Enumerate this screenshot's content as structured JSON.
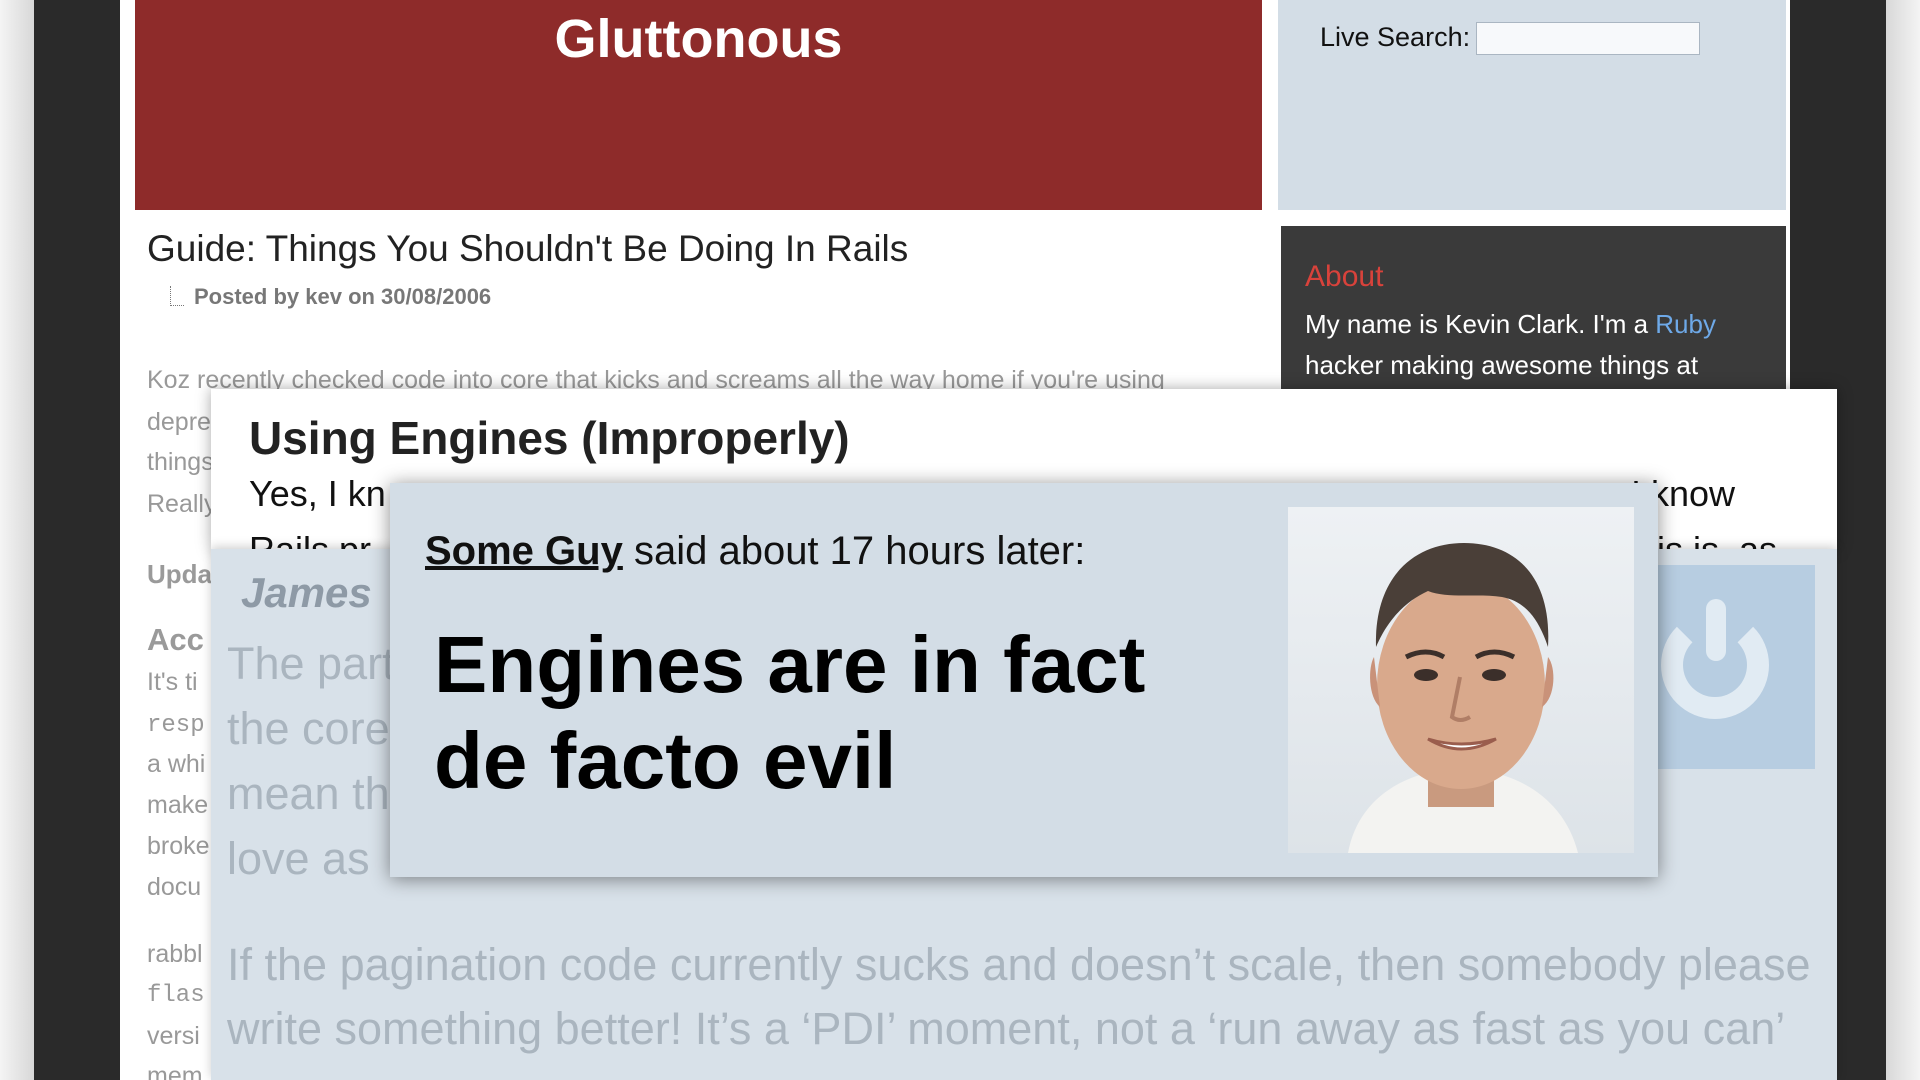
{
  "banner": {
    "title": "Gluttonous"
  },
  "search": {
    "label": "Live Search:",
    "value": ""
  },
  "about": {
    "heading": "About",
    "text_before": "My name is Kevin Clark. I'm a ",
    "link": "Ruby",
    "text_after": "hacker making awesome things at"
  },
  "post": {
    "title": "Guide: Things You Shouldn't Be Doing In Rails",
    "meta": "Posted by kev on 30/08/2006",
    "lines": [
      "Koz recently checked code into core that kicks and screams all the way home if you're using",
      "depre",
      "things",
      "Really",
      "Upda",
      "Acc",
      "It's ti",
      "resp",
      "a whi",
      "make",
      "broke",
      "docu",
      "rabbl",
      "flas",
      "versi",
      "mem"
    ]
  },
  "engines_card": {
    "title": "Using Engines (Improperly)",
    "line1_start": "Yes, I kn",
    "line1_end": ", I know",
    "line2_start": "Rails pr",
    "line2_end": "is is, as"
  },
  "comment_card": {
    "author": "James",
    "lines": [
      "The part",
      "the core",
      "mean th",
      "love as"
    ],
    "bottom_lines": [
      "If the pagination code currently sucks and doesn’t scale, then somebody please",
      "write something better! It’s a ‘PDI’ moment, not a ‘run away as fast as you can’"
    ]
  },
  "quote_card": {
    "author": "Some Guy",
    "said": " said about 17 hours later:",
    "quote_line1": "Engines are in fact",
    "quote_line2": "de facto evil"
  },
  "colors": {
    "banner": "#8e2b2a",
    "panel": "#d3dde6",
    "about_bg": "#3a3a3a",
    "about_heading": "#d8423b",
    "link": "#6ea9e8"
  }
}
